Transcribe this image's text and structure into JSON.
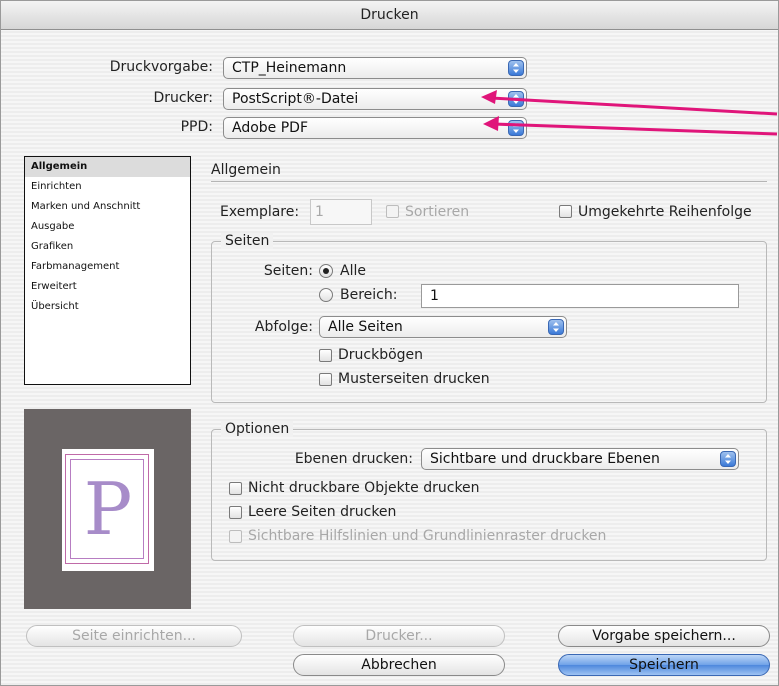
{
  "window": {
    "title": "Drucken"
  },
  "top": {
    "preset_label": "Druckvorgabe:",
    "preset_value": "CTP_Heinemann",
    "printer_label": "Drucker:",
    "printer_value": "PostScript®-Datei",
    "ppd_label": "PPD:",
    "ppd_value": "Adobe PDF"
  },
  "categories": {
    "items": [
      "Allgemein",
      "Einrichten",
      "Marken und Anschnitt",
      "Ausgabe",
      "Grafiken",
      "Farbmanagement",
      "Erweitert",
      "Übersicht"
    ],
    "selected": "Allgemein"
  },
  "general": {
    "heading": "Allgemein",
    "copies_label": "Exemplare:",
    "copies_value": "1",
    "collate_label": "Sortieren",
    "reverse_label": "Umgekehrte Reihenfolge"
  },
  "pages": {
    "group_title": "Seiten",
    "pages_label": "Seiten:",
    "all_label": "Alle",
    "range_label": "Bereich:",
    "range_value": "1",
    "sequence_label": "Abfolge:",
    "sequence_value": "Alle Seiten",
    "spreads_label": "Druckbögen",
    "master_label": "Musterseiten drucken"
  },
  "options": {
    "group_title": "Optionen",
    "layers_label": "Ebenen drucken:",
    "layers_value": "Sichtbare und druckbare Ebenen",
    "nonprint_label": "Nicht druckbare Objekte drucken",
    "blank_label": "Leere Seiten drucken",
    "guides_label": "Sichtbare Hilfslinien und Grundlinienraster drucken"
  },
  "preview": {
    "letter": "P"
  },
  "buttons": {
    "page_setup": "Seite einrichten...",
    "printer": "Drucker...",
    "save_preset": "Vorgabe speichern...",
    "cancel": "Abbrechen",
    "save": "Speichern"
  },
  "colors": {
    "annotation_arrow": "#e0157a",
    "accent": "#4e88dd"
  }
}
